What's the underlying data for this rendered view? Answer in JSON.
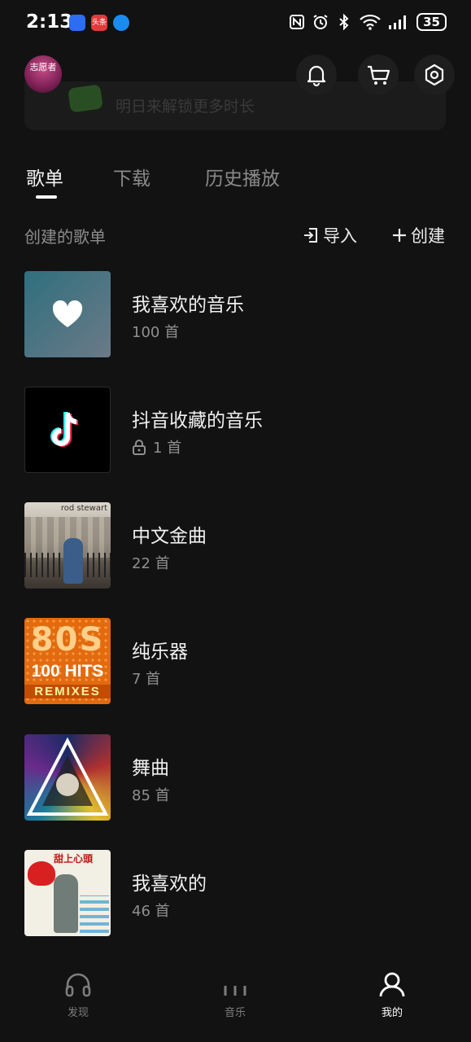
{
  "status_bar": {
    "time": "2:13",
    "battery": "35",
    "app_badge_label": "头条"
  },
  "header": {
    "avatar_text": "志愿者",
    "banner_text": "明日来解锁更多时长"
  },
  "tabs": [
    {
      "label": "歌单",
      "active": true
    },
    {
      "label": "下载",
      "active": false
    },
    {
      "label": "历史播放",
      "active": false
    }
  ],
  "section": {
    "title": "创建的歌单",
    "import_label": "导入",
    "create_label": "创建"
  },
  "playlists": [
    {
      "title": "我喜欢的音乐",
      "count": "100 首",
      "locked": false
    },
    {
      "title": "抖音收藏的音乐",
      "count": "1 首",
      "locked": true
    },
    {
      "title": "中文金曲",
      "count": "22 首",
      "locked": false
    },
    {
      "title": "纯乐器",
      "count": "7 首",
      "locked": false
    },
    {
      "title": "舞曲",
      "count": "85 首",
      "locked": false
    },
    {
      "title": "我喜欢的",
      "count": "46 首",
      "locked": false
    }
  ],
  "covers": {
    "cover3_text": "rod stewart",
    "cover4_line1": "80S",
    "cover4_line2": "100 HITS",
    "cover4_line3": "REMIXES",
    "cover6_text": "甜上心頭"
  },
  "bottom_nav": [
    {
      "label": "发现",
      "icon": "headphones-icon",
      "active": false
    },
    {
      "label": "音乐",
      "icon": "bars-icon",
      "active": false
    },
    {
      "label": "我的",
      "icon": "user-icon",
      "active": true
    }
  ],
  "colors": {
    "background": "#121212",
    "text_primary": "#f0f0f0",
    "text_secondary": "#8c8c8c"
  }
}
